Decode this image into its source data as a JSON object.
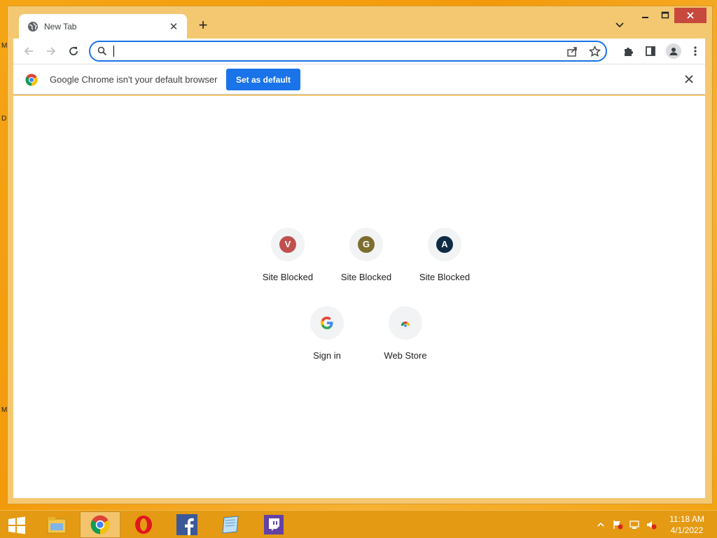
{
  "desktop": {
    "edge_glyphs": [
      "M",
      "D",
      "M"
    ]
  },
  "browser": {
    "tab": {
      "title": "New Tab",
      "icon": "globe-icon"
    },
    "window_controls": [
      "minimize",
      "maximize",
      "close"
    ],
    "toolbar": {
      "back_icon": "arrow-left-icon",
      "forward_icon": "arrow-right-icon",
      "reload_icon": "reload-icon",
      "omnibox_value": "",
      "omnibox_icon": "search-icon",
      "share_icon": "share-icon",
      "bookmark_icon": "star-icon",
      "extensions_icon": "puzzle-icon",
      "side_panel_icon": "side-panel-icon",
      "profile_icon": "avatar-icon",
      "menu_icon": "kebab-menu-icon"
    },
    "infobar": {
      "message": "Google Chrome isn't your default browser",
      "button_label": "Set as default"
    },
    "shortcuts": [
      {
        "letter": "V",
        "label": "Site Blocked",
        "color": "#c0504d"
      },
      {
        "letter": "G",
        "label": "Site Blocked",
        "color": "#7d6e2f"
      },
      {
        "letter": "A",
        "label": "Site Blocked",
        "color": "#0f2a44"
      },
      {
        "letter": "",
        "label": "Sign in",
        "icon": "google-g-icon"
      },
      {
        "letter": "",
        "label": "Web Store",
        "icon": "chrome-web-store-icon"
      }
    ]
  },
  "taskbar": {
    "apps": [
      "file-explorer-icon",
      "chrome-icon",
      "opera-icon",
      "facebook-icon",
      "notepad-icon",
      "twitch-icon"
    ],
    "active_app": "chrome-icon",
    "tray": [
      "show-hidden-icons",
      "action-center-flag-icon",
      "network-icon",
      "volume-muted-icon"
    ],
    "time": "11:18 AM",
    "date": "4/1/2022"
  }
}
